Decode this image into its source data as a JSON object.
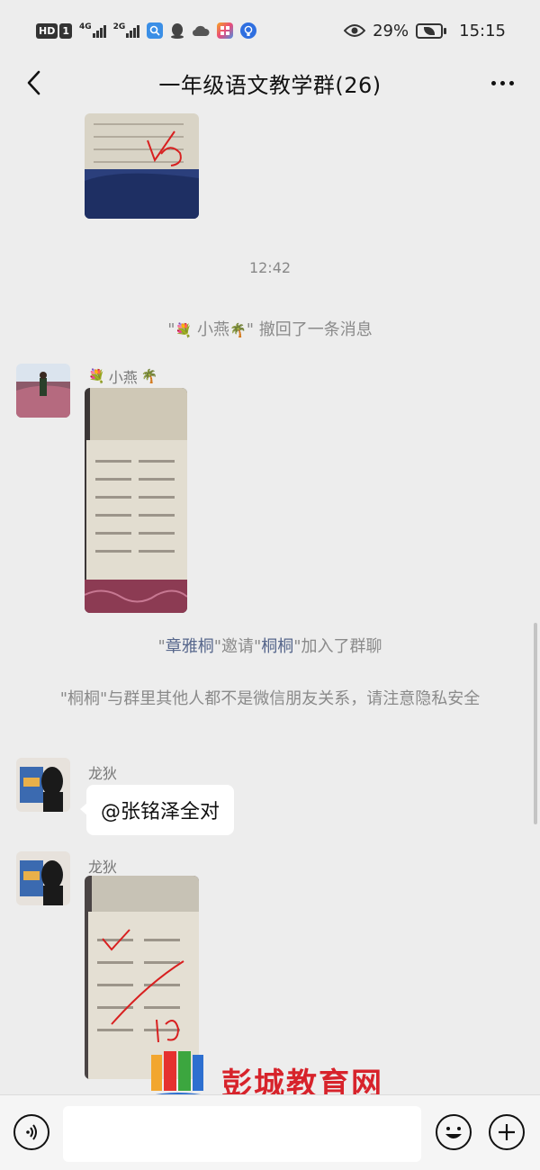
{
  "status_bar": {
    "hd_badge": "HD",
    "sim_badge": "1",
    "net1": "4G",
    "net2": "2G",
    "battery_percent": "29%",
    "time": "15:15",
    "icons": [
      "hd-badge",
      "signal-4g-icon",
      "signal-2g-icon",
      "search-app-icon",
      "qq-icon",
      "cloud-icon",
      "app-grid-icon",
      "bulb-icon",
      "eye-icon",
      "battery-icon"
    ]
  },
  "nav": {
    "title": "一年级语文教学群(26)",
    "back_icon": "chevron-left-icon",
    "more_icon": "more-dots-icon"
  },
  "messages": {
    "timestamp": "12:42",
    "recall_notice": {
      "prefix": "\"",
      "emoji_left": "💐",
      "name": " 小燕",
      "emoji_right": "🌴",
      "suffix": "\" 撤回了一条消息"
    },
    "sender1": {
      "emoji_left": "💐",
      "name": "小燕",
      "emoji_right": "🌴"
    },
    "invite_notice": {
      "q1": "\"",
      "inviter": "章雅桐",
      "q2": "\"邀请\"",
      "invitee": "桐桐",
      "q3": "\"加入了群聊"
    },
    "privacy_notice": "\"桐桐\"与群里其他人都不是微信朋友关系，请注意隐私安全",
    "sender2": "龙狄",
    "text_message": "@张铭泽全对",
    "sender3": "龙狄"
  },
  "input_bar": {
    "voice_icon": "voice-icon",
    "emoji_icon": "smiley-icon",
    "plus_icon": "plus-icon"
  },
  "watermark": {
    "text": "彭城教育网"
  },
  "colors": {
    "background": "#ededed",
    "system_link": "#57678c",
    "watermark_red": "#d7232b"
  }
}
